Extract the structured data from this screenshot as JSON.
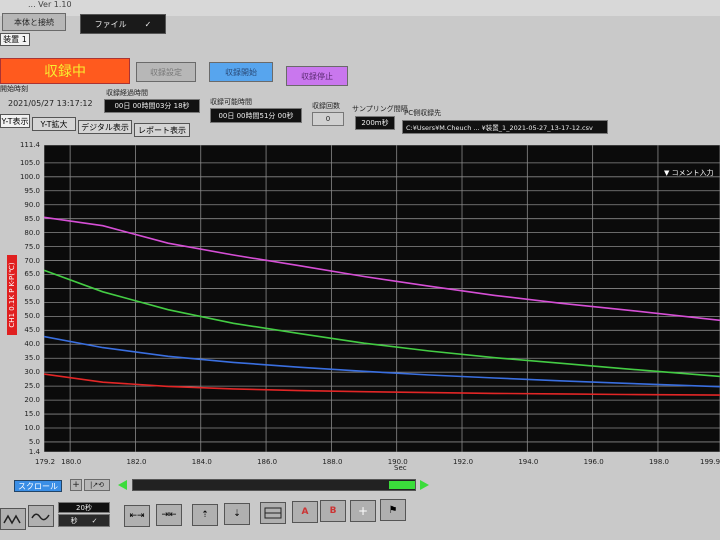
{
  "window": {
    "title": "... Ver 1.10"
  },
  "toolbar": {
    "main_unit_label": "本体と接続",
    "file_menu": "ファイル",
    "device_tab": "装置 1",
    "recording_status": "収録中",
    "record_settings": "収録設定",
    "record_start": "収録開始",
    "record_stop": "収録停止"
  },
  "status": {
    "start_time_label": "開始時刻",
    "start_time": "2021/05/27 13:17:12",
    "elapsed_label": "収録経過時間",
    "elapsed": "00日 00時間03分 18秒",
    "remaining_label": "収録可能時間",
    "remaining": "00日 00時間51分 00秒",
    "count_label": "収録回数",
    "count": "0",
    "interval_label": "サンプリング間隔",
    "interval": "200m秒",
    "pc_dest_label": "PC側収録先",
    "pc_dest": "C:¥Users¥M.Cheuch ... ¥装置_1_2021-05-27_13-17-12.csv"
  },
  "tabs": [
    "Y-T表示",
    "Y-T拡大",
    "デジタル表示",
    "レポート表示"
  ],
  "plot": {
    "comment_button": "▼ コメント入力",
    "y_axis_title": "CH1 0.1K P  K-P(℃)",
    "x_axis_unit": "Sec"
  },
  "chart_data": {
    "type": "line",
    "title": "",
    "xlabel": "Sec",
    "ylabel": "CH1 0.1K P  K-P(℃)",
    "xlim": [
      179.2,
      199.9
    ],
    "ylim": [
      1.4,
      111.4
    ],
    "x_ticks": [
      "179.2",
      "180.0",
      "182.0",
      "184.0",
      "186.0",
      "188.0",
      "190.0",
      "192.0",
      "194.0",
      "196.0",
      "198.0",
      "199.9"
    ],
    "y_ticks": [
      "111.4",
      "105.0",
      "100.0",
      "95.0",
      "90.0",
      "85.0",
      "80.0",
      "75.0",
      "70.0",
      "65.0",
      "60.0",
      "55.0",
      "50.0",
      "45.0",
      "40.0",
      "35.0",
      "30.0",
      "25.0",
      "20.0",
      "15.0",
      "10.0",
      "5.0",
      "1.4"
    ],
    "grid": true,
    "series": [
      {
        "color": "#d64fd6",
        "x": [
          179.2,
          181,
          183,
          185,
          187,
          189,
          191,
          193,
          195,
          197,
          199.9
        ],
        "y": [
          85.5,
          82.5,
          76.2,
          72.0,
          68.2,
          64.3,
          60.8,
          57.5,
          54.7,
          52.3,
          48.6
        ]
      },
      {
        "color": "#44cc44",
        "x": [
          179.2,
          181,
          183,
          185,
          187,
          189,
          191,
          193,
          195,
          197,
          199.9
        ],
        "y": [
          66.5,
          58.8,
          52.4,
          47.5,
          43.9,
          40.4,
          37.6,
          35.2,
          33.2,
          31.2,
          28.5
        ]
      },
      {
        "color": "#3a6fe0",
        "x": [
          179.2,
          181,
          183,
          185,
          187,
          189,
          191,
          193,
          195,
          197,
          199.9
        ],
        "y": [
          42.8,
          38.8,
          35.7,
          33.5,
          31.8,
          30.3,
          29.0,
          27.9,
          26.9,
          26.0,
          24.8
        ]
      },
      {
        "color": "#e22626",
        "x": [
          179.2,
          181,
          183,
          185,
          187,
          189,
          191,
          193,
          195,
          197,
          199.9
        ],
        "y": [
          29.3,
          26.4,
          24.9,
          24.0,
          23.4,
          23.0,
          22.7,
          22.4,
          22.2,
          22.0,
          21.8
        ]
      }
    ]
  },
  "bottom": {
    "scroll_label": "スクロール",
    "span_value": "20秒",
    "span_unit": "秒"
  }
}
